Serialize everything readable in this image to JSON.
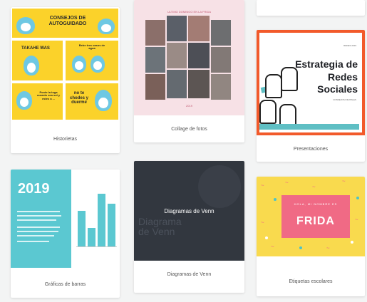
{
  "cards": [
    {
      "id": "historietas",
      "caption": "Historietas"
    },
    {
      "id": "collage",
      "caption": "Collage de fotos"
    },
    {
      "id": "presentaciones",
      "caption": "Presentaciones"
    },
    {
      "id": "graficas",
      "caption": "Gráficas de barras"
    },
    {
      "id": "venn",
      "caption": "Diagramas de Venn"
    },
    {
      "id": "etiquetas",
      "caption": "Etiquetas escolares"
    }
  ],
  "comic": {
    "title": "CONSEJOS DE AUTOGUIDADO",
    "t1": "TAKAHE WAS",
    "t2": "Bebe tres vasos de agua",
    "t3": "Ponte la toga cuando sea sol y estes a ...",
    "t4": "no te chodes y duerme"
  },
  "collage": {
    "header": "ULTIMO DOMINGO EN LA FRIDA",
    "footer": "2019"
  },
  "presentation": {
    "title": "Estrategia de Redes Sociales",
    "tag": "REDES 2019",
    "sub": "CONSEJOS DIGITALES"
  },
  "barchart": {
    "year": "2019"
  },
  "venn": {
    "label": "Diagramas de Venn",
    "ghost": "Diagrama de Venn"
  },
  "frida": {
    "sub": "HOLA, MI NOMBRE ES",
    "name": "FRIDA"
  }
}
